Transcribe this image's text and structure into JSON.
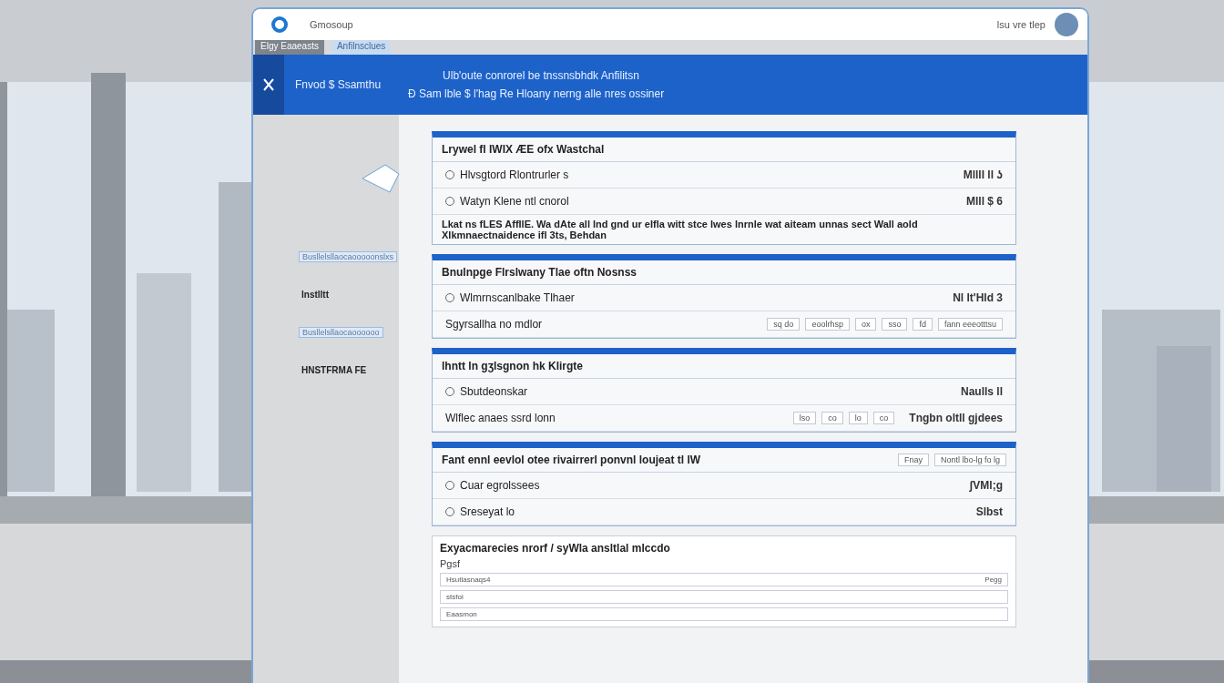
{
  "browser": {
    "tab_title": "Gmosoup",
    "account_label": "lsu vre tlep",
    "chips": [
      {
        "label": "Elgy Eaaeasts",
        "selected": true
      },
      {
        "label": "Anfilnsclues",
        "selected": false
      }
    ]
  },
  "banner": {
    "title": "Fnvod $ Ssamthu",
    "lines": [
      "Ulb'oute conrorel be tnssnsbhdk Anfilitsn",
      "Ð Sam lble $ l'hag Re Hloany  nerng alle nres ossiner"
    ]
  },
  "callouts": [
    "Busllelsllaocaooooonslxs",
    "lnstlltt",
    "Busllelsllaocaoooooo",
    "HNSTFRMA FE"
  ],
  "sections": [
    {
      "title": "Lrywel fl IWIX ÆE ofx Wastchal",
      "rows": [
        {
          "kind": "pair",
          "label": "Hlvsgtord Rlontrurler s",
          "value": "MlllI ll ʖ"
        },
        {
          "kind": "pair",
          "label": "Watyn Klene ntl cnorol",
          "value": "Mlll $ 6"
        },
        {
          "kind": "text",
          "text": "Lkat ns fLES AffIlE. Wa dAte all lnd gnd ur eIfla witt stce lwes lnrnle wat aiteam unnas sect Wall aold Xlkmnaectnaidence ifl 3ts, Behdan"
        }
      ]
    },
    {
      "title": "Bnulnpge Flrslwany Tlae oftn Nosnss",
      "rows": [
        {
          "kind": "pair",
          "label": "Wlmrnscanlbake Tlhaer",
          "value": "Nl lt'Hld 3"
        },
        {
          "kind": "fields",
          "label": "Sgyrsallha no mdlor",
          "fields": [
            "sq do",
            "eoolrhsp",
            "ox",
            "sso",
            "fd",
            "fann eeeotttsu"
          ]
        }
      ]
    },
    {
      "title": "lhntt ln gʒlsgnon hk Klirgte",
      "rows": [
        {
          "kind": "pair",
          "label": "Sbutdeonskar",
          "value": "Naulls ll"
        },
        {
          "kind": "fields",
          "label": "Wlflec anaes ssrd lonn",
          "fields": [
            "lso",
            "co",
            "lo",
            "co"
          ],
          "value": "Tngbn oltll gjdees"
        }
      ]
    },
    {
      "title": "Fant ennl eevlol otee rivairrerl ponvnl loujeat tl lW",
      "fields": [
        "Fnay",
        "Nontl lbo-lg fo   lg"
      ],
      "rows": [
        {
          "kind": "pair",
          "label": "Cuar egrolssees",
          "value": "ʃVMl;g"
        },
        {
          "kind": "pair",
          "label": "Sreseyat lo",
          "value": "Slbst"
        }
      ]
    }
  ],
  "form": {
    "title": "Exyacmarecies nrorf / syWla ansltlal mlccdo",
    "subtitle": "Pgsf",
    "rows": [
      {
        "label": "Hsutlasnaqs4",
        "value": "Pegg"
      },
      {
        "label": "stsfoi",
        "value": ""
      },
      {
        "label": "Eaasmon",
        "value": ""
      }
    ]
  }
}
